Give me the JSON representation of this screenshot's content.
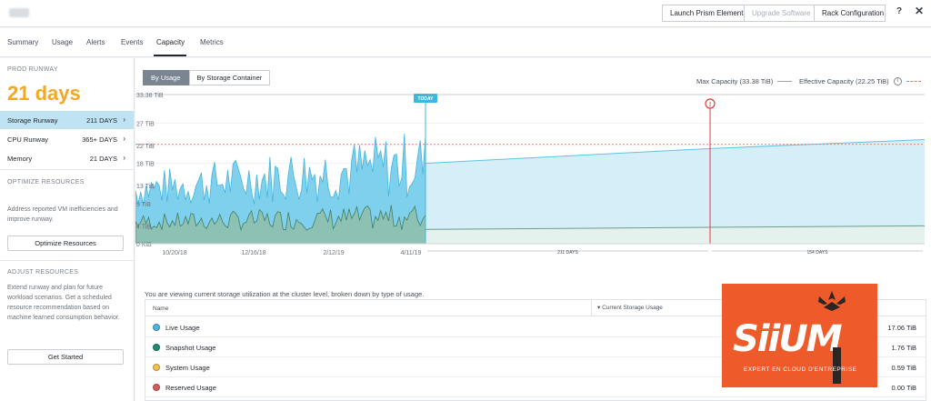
{
  "topbar": {
    "buttons": [
      "Launch Prism Element",
      "Upgrade Software",
      "Rack Configuration"
    ],
    "help": "?",
    "close": "✕"
  },
  "tabs": [
    "Summary",
    "Usage",
    "Alerts",
    "Events",
    "Capacity",
    "Metrics"
  ],
  "active_tab": "Capacity",
  "left": {
    "runway_label": "PROD RUNWAY",
    "runway_value": "21 days",
    "metrics": [
      {
        "label": "Storage Runway",
        "value": "211 DAYS",
        "active": true
      },
      {
        "label": "CPU Runway",
        "value": "365+ DAYS",
        "active": false
      },
      {
        "label": "Memory",
        "value": "21 DAYS",
        "active": false
      }
    ],
    "optimize_label": "OPTIMIZE RESOURCES",
    "optimize_desc": "Address reported VM inefficiencies and improve runway.",
    "optimize_button": "Optimize Resources",
    "adjust_label": "ADJUST RESOURCES",
    "adjust_desc": "Extend runway and plan for future workload scenarios. Get a scheduled resource recommendation based on machine learned consumption behavior.",
    "adjust_button": "Get Started"
  },
  "main": {
    "seg_buttons": [
      "By Usage",
      "By Storage Container"
    ],
    "legend_max": "Max Capacity (33.38 TiB)",
    "legend_effective": "Effective Capacity (22.25 TiB)",
    "caption": "You are viewing current storage utilization at the cluster level, broken down by type of usage.",
    "table_headers": {
      "name": "Name",
      "usage": "Current Storage Usage"
    }
  },
  "chart_data": {
    "type": "area",
    "y_ticks": [
      "33.38 TiB",
      "27 TiB",
      "22 TiB",
      "18 TiB",
      "13 TiB",
      "9 TiB",
      "4 TiB",
      "0 KiB"
    ],
    "y_tick_values": [
      33.38,
      27,
      22,
      18,
      13,
      9,
      4,
      0
    ],
    "x_ticks": [
      "10/20/18",
      "12/16/18",
      "2/12/19",
      "4/11/19"
    ],
    "today_label": "TODAY",
    "runway_labels": [
      "211 DAYS",
      "154 DAYS"
    ],
    "max_capacity": 33.38,
    "effective_capacity": 22.25,
    "series": [
      {
        "name": "Live Usage",
        "color": "#7fd0ec"
      },
      {
        "name": "Snapshot Usage",
        "color": "#7fb9a4"
      }
    ],
    "forecast_end_value": 23.3,
    "forecast_snapshot_end": 4.0,
    "colors": {
      "live": "#7fd0ec",
      "snapshot": "#8fbfae",
      "forecast": "#d6eef8",
      "today": "#3fb6dc",
      "alert": "#e23b3b"
    }
  },
  "usage_rows": [
    {
      "name": "Live Usage",
      "value": "17.06 TiB",
      "color": "#4ab6e1"
    },
    {
      "name": "Snapshot Usage",
      "value": "1.76 TiB",
      "color": "#1f8c73"
    },
    {
      "name": "System Usage",
      "value": "0.59 TiB",
      "color": "#f2c14e"
    },
    {
      "name": "Reserved Usage",
      "value": "0.00 TiB",
      "color": "#d75c5c"
    }
  ],
  "logo": {
    "text": "SiiUM",
    "sub": "EXPERT EN CLOUD D'ENTREPRISE"
  }
}
